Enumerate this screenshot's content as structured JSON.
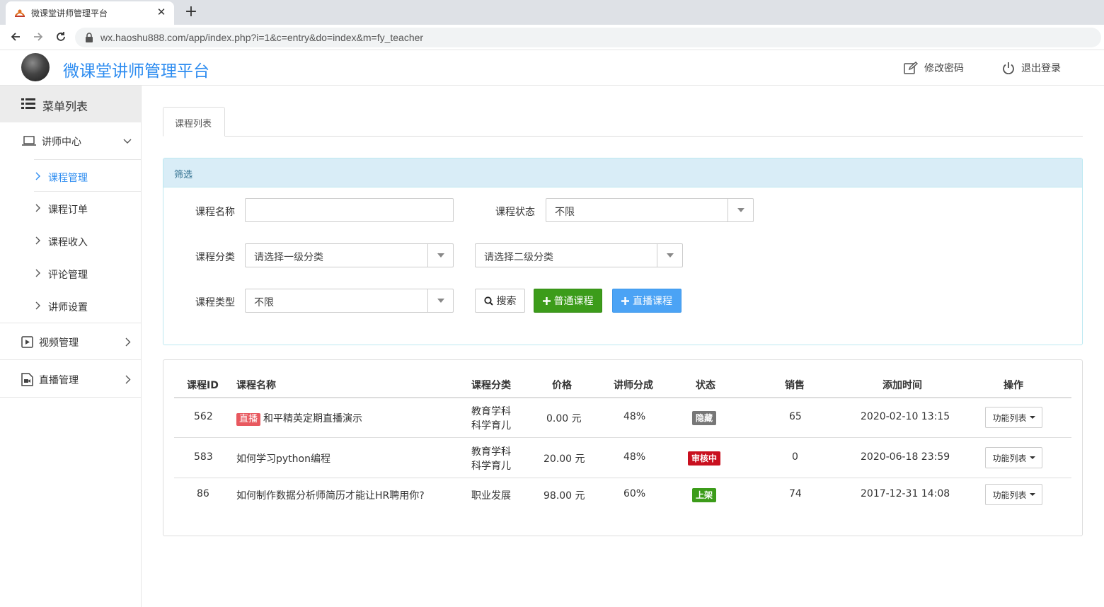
{
  "browser": {
    "tab_title": "微课堂讲师管理平台",
    "tab_close": "✕",
    "new_tab": "+",
    "url": "wx.haoshu888.com/app/index.php?i=1&c=entry&do=index&m=fy_teacher"
  },
  "header": {
    "title": "微课堂讲师管理平台",
    "change_password": "修改密码",
    "logout": "退出登录"
  },
  "sidebar": {
    "menu_title": "菜单列表",
    "groups": [
      {
        "label": "讲师中心",
        "expanded": true,
        "items": [
          {
            "label": "课程管理",
            "active": true
          },
          {
            "label": "课程订单"
          },
          {
            "label": "课程收入"
          },
          {
            "label": "评论管理"
          },
          {
            "label": "讲师设置"
          }
        ]
      },
      {
        "label": "视频管理",
        "expanded": false
      },
      {
        "label": "直播管理",
        "expanded": false
      }
    ]
  },
  "main": {
    "tab": "课程列表",
    "filter": {
      "title": "筛选",
      "name_label": "课程名称",
      "name_value": "",
      "status_label": "课程状态",
      "status_value": "不限",
      "category_label": "课程分类",
      "category1_value": "请选择一级分类",
      "category2_value": "请选择二级分类",
      "type_label": "课程类型",
      "type_value": "不限",
      "search_btn": "搜索",
      "normal_course_btn": "普通课程",
      "live_course_btn": "直播课程"
    },
    "table": {
      "columns": [
        "课程ID",
        "课程名称",
        "课程分类",
        "价格",
        "讲师分成",
        "状态",
        "销售",
        "添加时间",
        "操作"
      ],
      "rows": [
        {
          "id": "562",
          "tag": "直播",
          "name": "和平精英定期直播演示",
          "category": [
            "教育学科",
            "科学育儿"
          ],
          "price": "0.00 元",
          "share": "48%",
          "status": "隐藏",
          "sales": "65",
          "time": "2020-02-10 13:15",
          "action": "功能列表"
        },
        {
          "id": "583",
          "tag": "",
          "name": "如何学习python编程",
          "category": [
            "教育学科",
            "科学育儿"
          ],
          "price": "20.00 元",
          "share": "48%",
          "status": "审核中",
          "sales": "0",
          "time": "2020-06-18 23:59",
          "action": "功能列表"
        },
        {
          "id": "86",
          "tag": "",
          "name": "如何制作数据分析师简历才能让HR聘用你?",
          "category": [
            "职业发展"
          ],
          "price": "98.00 元",
          "share": "60%",
          "status": "上架",
          "sales": "74",
          "time": "2017-12-31 14:08",
          "action": "功能列表"
        }
      ]
    }
  },
  "colors": {
    "brand_blue": "#2d8cf0",
    "success_green": "#3c9c1a",
    "danger_red": "#c9101f",
    "muted_gray": "#777777",
    "live_tag": "#e8585f"
  }
}
